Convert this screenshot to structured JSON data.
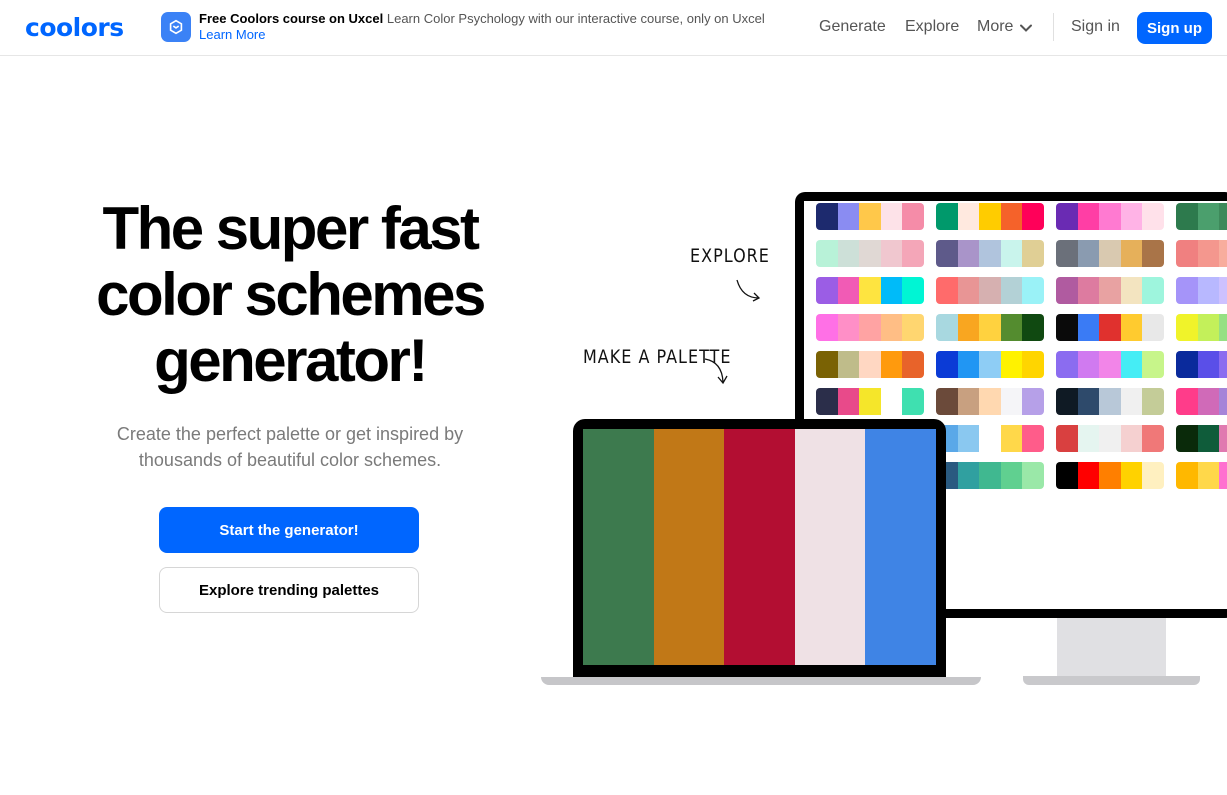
{
  "header": {
    "logo": "coolors",
    "promo": {
      "title": "Free Coolors course on Uxcel",
      "text": "Learn Color Psychology with our interactive course, only on Uxcel",
      "link": "Learn More",
      "icon": "uxcel-logo-icon"
    },
    "nav": {
      "generate": "Generate",
      "explore": "Explore",
      "more": "More",
      "more_icon": "chevron-down-icon",
      "signin": "Sign in",
      "signup": "Sign up"
    }
  },
  "hero": {
    "title_line1": "The super fast",
    "title_line2": "color schemes",
    "title_line3": "generator!",
    "subtitle": "Create the perfect palette or get inspired by thousands of beautiful color schemes.",
    "primary_cta": "Start the generator!",
    "secondary_cta": "Explore trending palettes"
  },
  "illustration": {
    "explore_label": "EXPLORE",
    "make_label": "MAKE A PALETTE",
    "laptop_palette": [
      "#3d7a4e",
      "#c17817",
      "#b30e32",
      "#efe1e5",
      "#3f84e5"
    ],
    "monitor_palettes": [
      [
        "#1d2a6e",
        "#8a8cf2",
        "#ffc84a",
        "#fde2e8",
        "#f58ca8"
      ],
      [
        "#00996b",
        "#ffe9df",
        "#ffcc00",
        "#f5622a",
        "#ff0059"
      ],
      [
        "#6a2bb3",
        "#ff3ea5",
        "#ff7ad1",
        "#ffb3e6",
        "#ffe1ea"
      ],
      [
        "#2d7a4d",
        "#4b9f6d",
        "#3e8a5b",
        "#7fb58f",
        "#a3c9ad"
      ],
      [
        "#b8f2d8",
        "#cde0d8",
        "#e0d8d4",
        "#f0c7cf",
        "#f4a6b8"
      ],
      [
        "#5e5a8a",
        "#a994c9",
        "#b0c4dd",
        "#c9f4ec",
        "#e0cf95"
      ],
      [
        "#6b707a",
        "#8a9bb0",
        "#d9c9b0",
        "#e6b05a",
        "#a97448"
      ],
      [
        "#f08080",
        "#f4978e",
        "#f8ad9d",
        "#fbc4ab",
        "#ffdab9"
      ],
      [
        "#9b5de5",
        "#f15bb5",
        "#fee440",
        "#00bbf9",
        "#00f5d4"
      ],
      [
        "#ff6b6b",
        "#e89595",
        "#d6b0b0",
        "#b3d1d6",
        "#9af2f7"
      ],
      [
        "#b05ba0",
        "#dd7ba0",
        "#e8a2a2",
        "#f3e4c0",
        "#9ef5dd"
      ],
      [
        "#a594f9",
        "#b8b8ff",
        "#cdc1ff",
        "#e5d9f2",
        "#f5efff"
      ],
      [
        "#ff70e6",
        "#ff8fc7",
        "#ffa3a3",
        "#ffbe85",
        "#ffd670"
      ],
      [
        "#a8d8e0",
        "#f9a620",
        "#ffd23f",
        "#548c2f",
        "#104911"
      ],
      [
        "#0a0a0a",
        "#3a7bf5",
        "#e0312e",
        "#ffcb2f",
        "#e8e8e8"
      ],
      [
        "#f0f32a",
        "#c3f05a",
        "#96e083",
        "#68d0ad",
        "#3bc0d6"
      ],
      [
        "#7a6204",
        "#bfbc8a",
        "#ffd7c2",
        "#ff9a0d",
        "#e8632a"
      ],
      [
        "#0b3bd6",
        "#2196f3",
        "#8ecdf5",
        "#fff200",
        "#ffd500"
      ],
      [
        "#8b6cf0",
        "#d07af0",
        "#f285e8",
        "#45edf5",
        "#c7f58a"
      ],
      [
        "#0a2a9c",
        "#5a4fe8",
        "#8b6cf0",
        "#c08ff5",
        "#e4c4f7"
      ],
      [
        "#2b2e4a",
        "#e84a8a",
        "#f5e62a",
        "#ffffff",
        "#3fe0b0"
      ],
      [
        "#6b4a3a",
        "#c8a080",
        "#ffd8b0",
        "#f5f5f8",
        "#b6a0e8"
      ],
      [
        "#0f1a24",
        "#2e4a6b",
        "#b8c8d8",
        "#f0f0f0",
        "#c4cc98"
      ],
      [
        "#ff3c8a",
        "#d06ab8",
        "#a684d8",
        "#7c9ee8",
        "#52b8f8"
      ],
      [
        "#1d5f80",
        "#3f9aba",
        "#7fc1d0",
        "#e8e8e8",
        "#f5a430"
      ],
      [
        "#5aa8e8",
        "#8ac8f0",
        "#ffffff",
        "#ffd84a",
        "#ff5c8a"
      ],
      [
        "#d94040",
        "#e5f5f0",
        "#f0f0f0",
        "#f5d0d0",
        "#f07878"
      ],
      [
        "#0a2a0a",
        "#0f5c3a",
        "#e07ab0",
        "#f8b0c8",
        "#fde8ef"
      ],
      [
        "#4a4240",
        "#8a8078",
        "#c0bab0",
        "#f0f0f0",
        "#e0b0a0"
      ],
      [
        "#2a5a80",
        "#30a0a0",
        "#40b890",
        "#60d090",
        "#9ae8a8"
      ],
      [
        "#000000",
        "#ff0000",
        "#ff7f00",
        "#ffd200",
        "#fff0c0"
      ],
      [
        "#ffb800",
        "#ffd84a",
        "#ff70d0",
        "#1c7ac0",
        "#00b060"
      ],
      [
        "#7a6a6a",
        "#b0a0a0",
        "#e0d0d0",
        "#f0e8e8",
        "#fff8f8"
      ]
    ]
  }
}
